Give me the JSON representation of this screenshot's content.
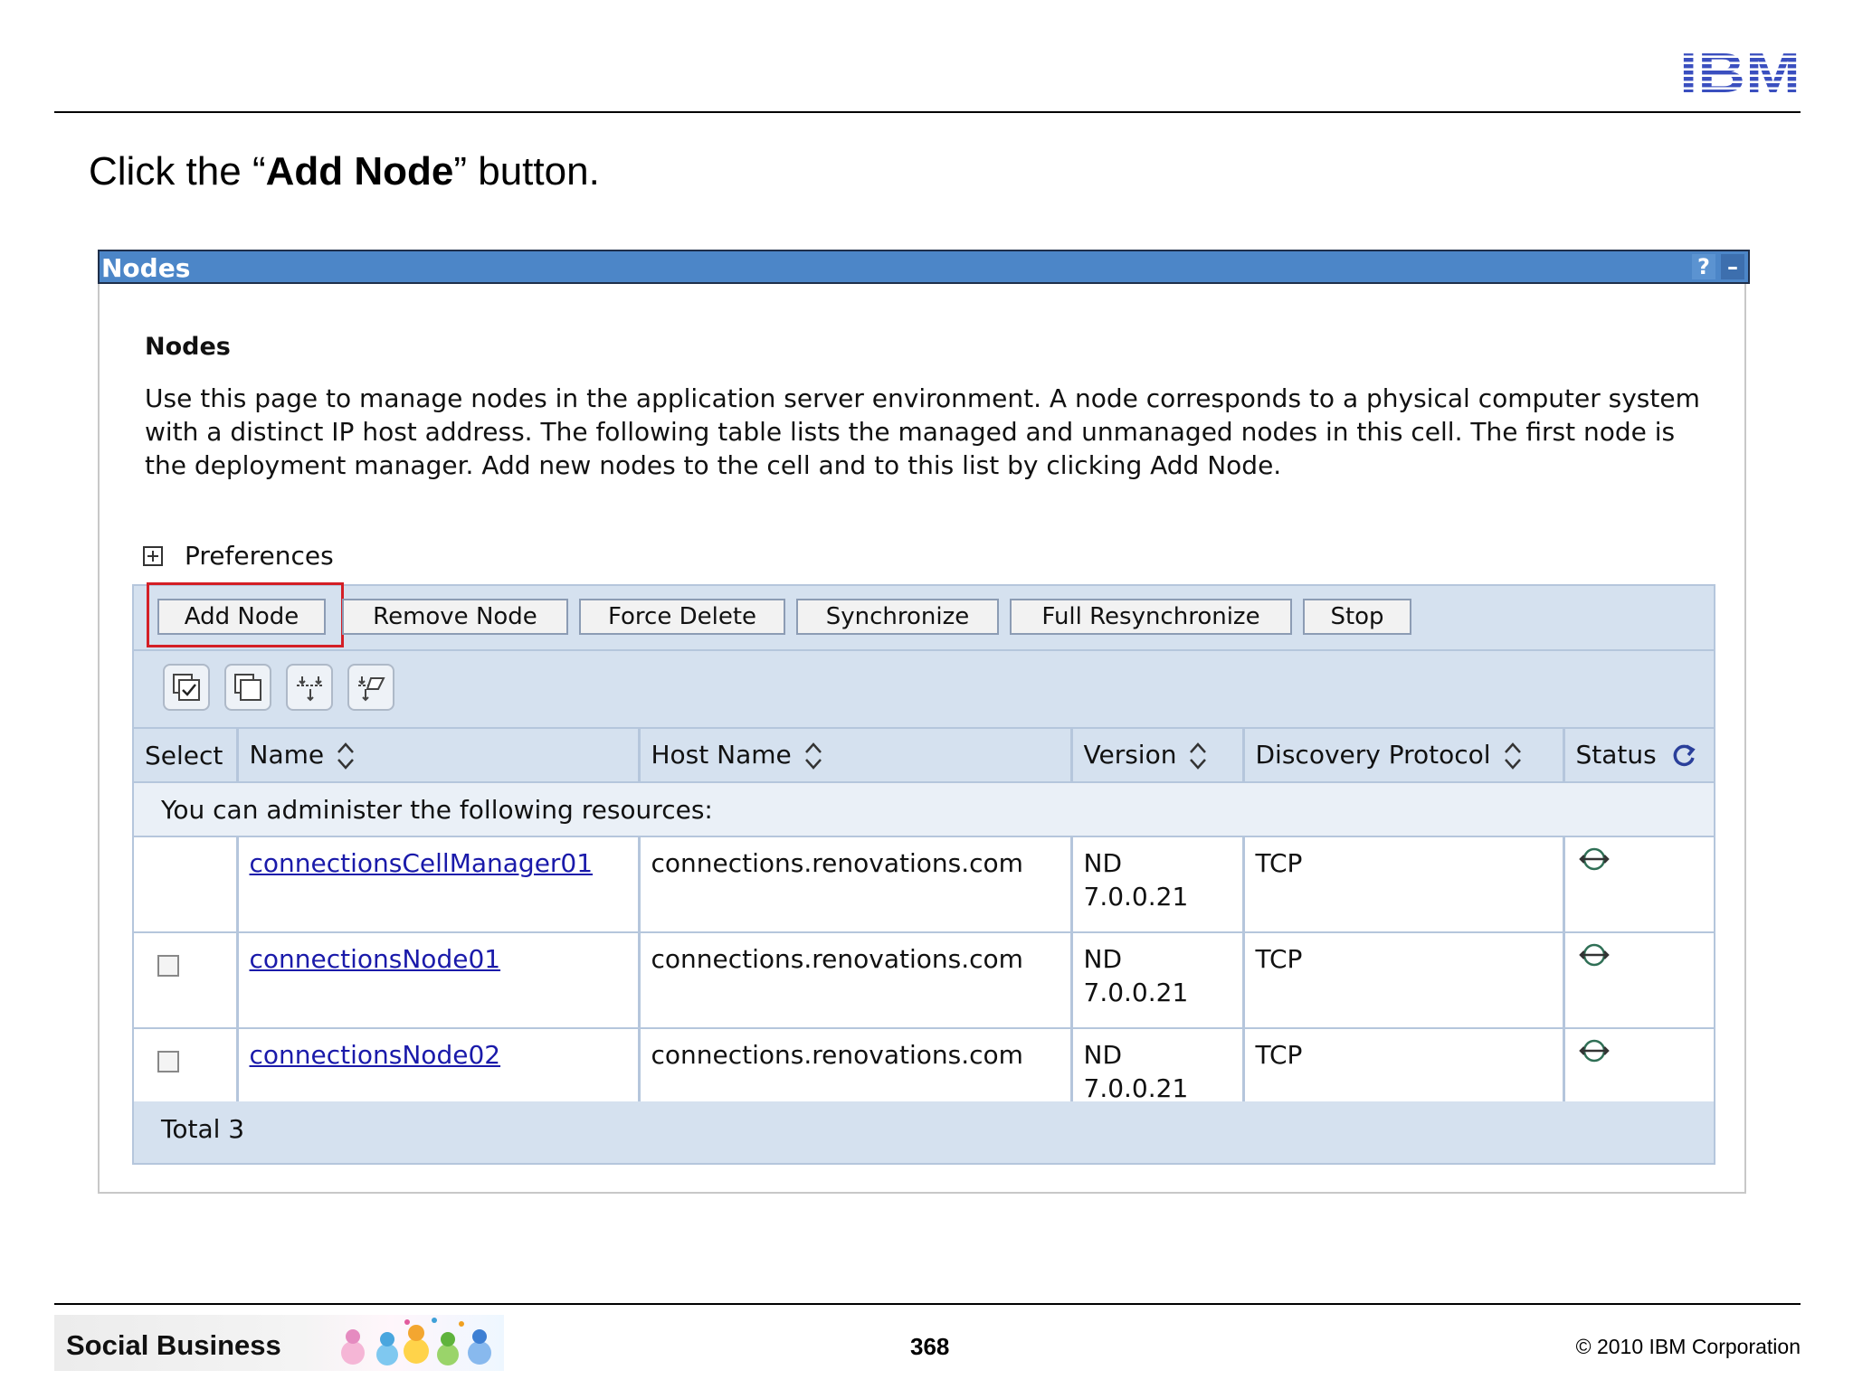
{
  "slide": {
    "logo_text": "IBM",
    "instruction_prefix": "Click the “",
    "instruction_bold": "Add Node",
    "instruction_suffix": "” button.",
    "footer_brand": "Social Business",
    "page_number": "368",
    "copyright": "© 2010 IBM Corporation"
  },
  "panel": {
    "title": "Nodes",
    "help_label": "?",
    "minimize_label": "–",
    "heading": "Nodes",
    "description": "Use this page to manage nodes in the application server environment. A node corresponds to a physical computer system with a distinct IP host address. The following table lists the managed and unmanaged nodes in this cell. The first node is the deployment manager. Add new nodes to the cell and to this list by clicking Add Node.",
    "preferences_label": "Preferences"
  },
  "buttons": {
    "add_node": "Add Node",
    "remove_node": "Remove Node",
    "force_delete": "Force Delete",
    "synchronize": "Synchronize",
    "full_resync": "Full Resynchronize",
    "stop": "Stop"
  },
  "toolbar_icons": [
    "select-all-icon",
    "deselect-all-icon",
    "show-filter-icon",
    "clear-filter-icon"
  ],
  "table": {
    "headers": {
      "select": "Select",
      "name": "Name",
      "host": "Host Name",
      "version": "Version",
      "protocol": "Discovery Protocol",
      "status": "Status"
    },
    "info": "You can administer the following resources:",
    "rows": [
      {
        "name": "connectionsCellManager01",
        "host": "connections.renovations.com",
        "version_line1": "ND",
        "version_line2": "7.0.0.21",
        "protocol": "TCP",
        "selectable": false
      },
      {
        "name": "connectionsNode01",
        "host": "connections.renovations.com",
        "version_line1": "ND",
        "version_line2": "7.0.0.21",
        "protocol": "TCP",
        "selectable": true
      },
      {
        "name": "connectionsNode02",
        "host": "connections.renovations.com",
        "version_line1": "ND",
        "version_line2": "7.0.0.21",
        "protocol": "TCP",
        "selectable": true
      }
    ],
    "total": "Total 3"
  },
  "colors": {
    "title_bar": "#4c86c8",
    "grid_header": "#d5e1ef",
    "highlight": "#d41f26",
    "link": "#1a1aaa"
  }
}
